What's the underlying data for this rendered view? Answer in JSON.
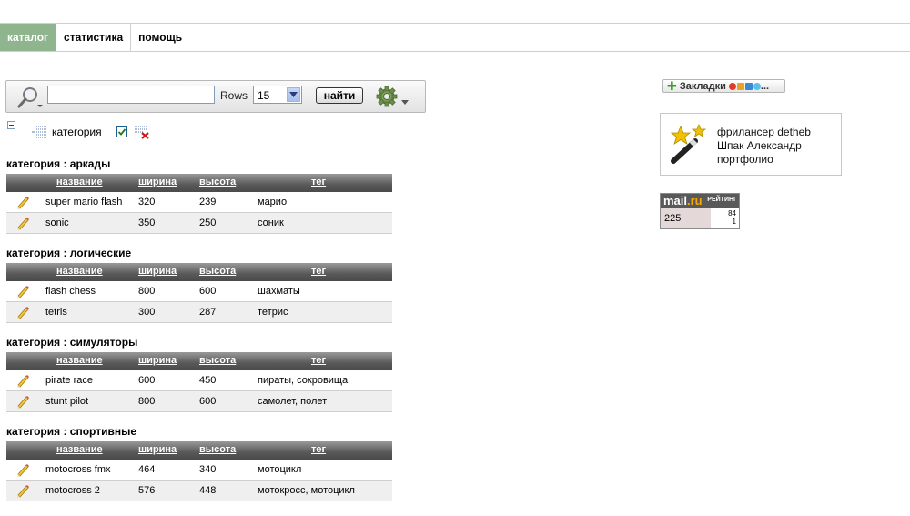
{
  "nav": {
    "tabs": [
      {
        "label": "каталог",
        "active": true
      },
      {
        "label": "статистика",
        "active": false
      },
      {
        "label": "помощь",
        "active": false
      }
    ]
  },
  "search": {
    "value": "",
    "rows_label": "Rows",
    "rows_value": "15",
    "find_label": "найти"
  },
  "filter": {
    "label": "категория"
  },
  "columns": {
    "name": "название",
    "width": "ширина",
    "height": "высота",
    "tag": "тег"
  },
  "groups": [
    {
      "title": "категория : аркады",
      "rows": [
        {
          "name": "super mario flash",
          "width": "320",
          "height": "239",
          "tag": "марио"
        },
        {
          "name": "sonic",
          "width": "350",
          "height": "250",
          "tag": "соник"
        }
      ]
    },
    {
      "title": "категория : логические",
      "rows": [
        {
          "name": "flash chess",
          "width": "800",
          "height": "600",
          "tag": "шахматы"
        },
        {
          "name": "tetris",
          "width": "300",
          "height": "287",
          "tag": "тетрис"
        }
      ]
    },
    {
      "title": "категория : симуляторы",
      "rows": [
        {
          "name": "pirate race",
          "width": "600",
          "height": "450",
          "tag": "пираты, сокровища"
        },
        {
          "name": "stunt pilot",
          "width": "800",
          "height": "600",
          "tag": "самолет, полет"
        }
      ]
    },
    {
      "title": "категория : спортивные",
      "rows": [
        {
          "name": "motocross fmx",
          "width": "464",
          "height": "340",
          "tag": "мотоцикл"
        },
        {
          "name": "motocross 2",
          "width": "576",
          "height": "448",
          "tag": "мотокросс, мотоцикл"
        }
      ]
    }
  ],
  "bookmarks": {
    "label": "Закладки",
    "more": "..."
  },
  "promo": {
    "line1": "фрилансер detheb",
    "line2": "Шпак Александр",
    "line3": "портфолио"
  },
  "mailru": {
    "logo_main": "mail",
    "logo_suffix": ".ru",
    "rating_label": "РЕЙТИНГ",
    "count": "225",
    "small1": "84",
    "small2": "1"
  },
  "colors": {
    "active_tab": "#8fb58f",
    "grid_header": "#595959",
    "row_alt": "#efefef"
  },
  "icons": [
    "search-icon",
    "chevron-down-icon",
    "gear-icon",
    "collapse-icon",
    "filter-icon",
    "checkbox-icon",
    "remove-filter-icon",
    "pencil-icon",
    "plus-icon",
    "magic-wand-icon"
  ]
}
